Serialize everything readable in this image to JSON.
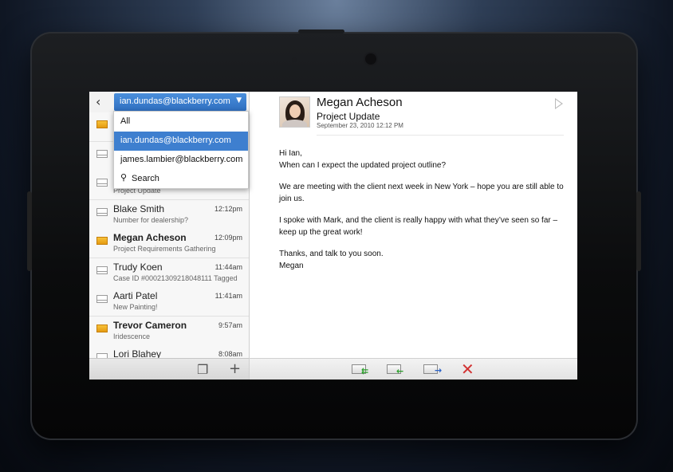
{
  "account_dropdown": {
    "selected": "ian.dundas@blackberry.com",
    "options": [
      "All",
      "ian.dundas@blackberry.com",
      "james.lambier@blackberry.com",
      "Search"
    ]
  },
  "messages": [
    {
      "name": "",
      "time": "",
      "subject": "",
      "unread": true
    },
    {
      "name": "",
      "time": "",
      "subject": "",
      "unread": false
    },
    {
      "name": "",
      "time": "",
      "subject": "Project Update",
      "unread": false
    },
    {
      "name": "Blake Smith",
      "time": "12:12pm",
      "subject": "Number for dealership?",
      "unread": false
    },
    {
      "name": "Megan Acheson",
      "time": "12:09pm",
      "subject": "Project Requirements Gathering",
      "unread": true
    },
    {
      "name": "Trudy Koen",
      "time": "11:44am",
      "subject": "Case ID #00021309218048111 Tagged",
      "unread": false
    },
    {
      "name": "Aarti Patel",
      "time": "11:41am",
      "subject": "New Painting!",
      "unread": false
    },
    {
      "name": "Trevor Cameron",
      "time": "9:57am",
      "subject": "Iridescence",
      "unread": true
    },
    {
      "name": "Lori Blahey",
      "time": "8:08am",
      "subject": "",
      "unread": false
    }
  ],
  "email": {
    "sender": "Megan Acheson",
    "subject": "Project Update",
    "date": "September 23, 2010 12:12 PM",
    "body": [
      "Hi Ian,\nWhen can I expect the updated project outline?",
      "We are meeting with the client next week in New York – hope you are still able to join us.",
      "I spoke with Mark, and the client is really happy with what they’ve seen so far – keep up the great work!",
      "Thanks, and talk to you soon.\nMegan"
    ]
  },
  "icons": {
    "back": "chevron-left-icon",
    "caret": "caret-down-icon",
    "search": "magnifier-icon",
    "multi_select": "multi-select-icon",
    "compose": "plus-icon",
    "reply": "reply-icon",
    "reply_all": "reply-all-icon",
    "forward": "forward-icon",
    "delete": "delete-x-icon",
    "flag": "flag-icon"
  },
  "colors": {
    "accent": "#3e7fcf",
    "unread_envelope": "#f2b22c",
    "delete": "#d23333"
  }
}
